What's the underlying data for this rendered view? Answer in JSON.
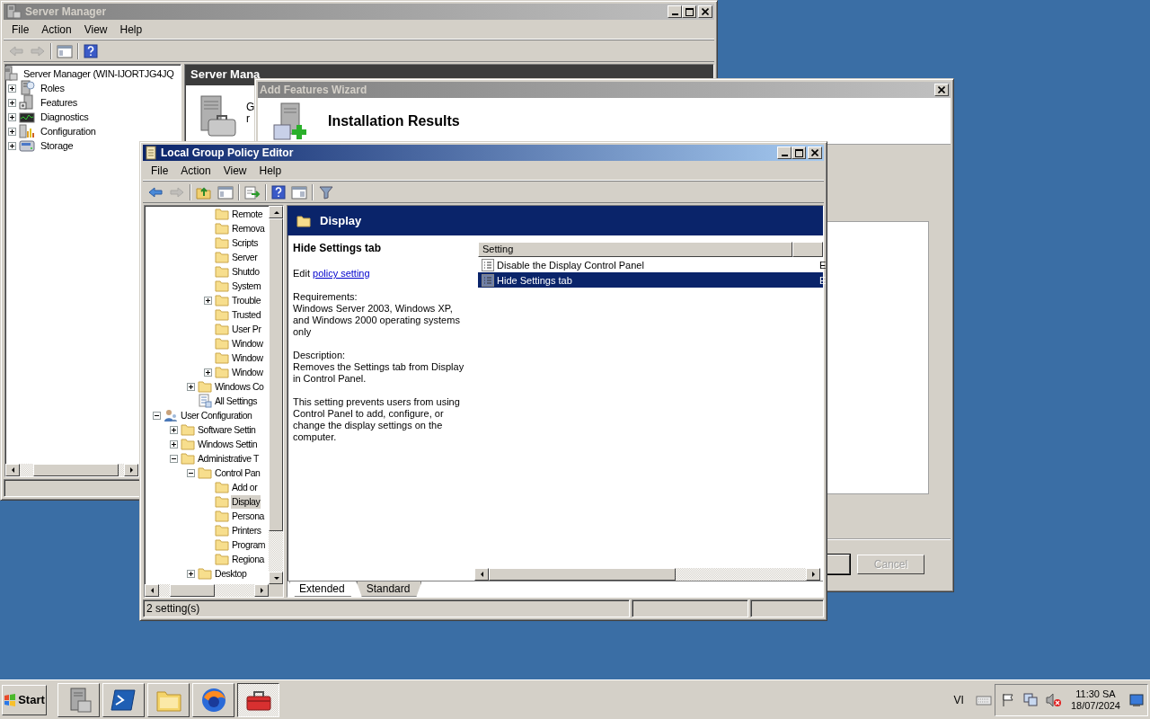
{
  "server_manager": {
    "title": "Server Manager",
    "menu": [
      "File",
      "Action",
      "View",
      "Help"
    ],
    "toolbar": [
      [
        {
          "kind": "back",
          "disabled": true
        },
        {
          "kind": "forward",
          "disabled": true
        }
      ],
      [
        {
          "kind": "tree-toggle",
          "disabled": false
        }
      ],
      [
        {
          "kind": "help",
          "disabled": false
        }
      ]
    ],
    "tree": [
      {
        "label": "Server Manager (WIN-IJORTJG4JQ",
        "kind": "server",
        "selected": false,
        "children": [
          {
            "label": "Roles",
            "kind": "roles",
            "expanded": false,
            "selected": false
          },
          {
            "label": "Features",
            "kind": "features",
            "expanded": false,
            "selected": false
          },
          {
            "label": "Diagnostics",
            "kind": "diagnostics",
            "expanded": false,
            "selected": false
          },
          {
            "label": "Configuration",
            "kind": "configuration",
            "expanded": false,
            "selected": false
          },
          {
            "label": "Storage",
            "kind": "storage",
            "expanded": false,
            "selected": false
          }
        ]
      }
    ],
    "pane_header": "Server Mana",
    "pane_text": [
      "G",
      "r"
    ]
  },
  "wizard": {
    "title": "Add Features Wizard",
    "heading": "Installation Results",
    "buttons": [
      {
        "disabled": false
      },
      {
        "label": "Cancel",
        "disabled": true
      }
    ]
  },
  "policy_editor": {
    "title": "Local Group Policy Editor",
    "menu": [
      "File",
      "Action",
      "View",
      "Help"
    ],
    "toolbar": [
      [
        {
          "kind": "back",
          "disabled": false
        },
        {
          "kind": "forward",
          "disabled": true
        }
      ],
      [
        {
          "kind": "up",
          "disabled": false
        },
        {
          "kind": "tree-toggle",
          "disabled": false
        }
      ],
      [
        {
          "kind": "export",
          "disabled": false
        }
      ],
      [
        {
          "kind": "help",
          "disabled": false
        },
        {
          "kind": "properties",
          "disabled": false
        }
      ],
      [
        {
          "kind": "filter",
          "disabled": false
        }
      ]
    ],
    "tree": [
      {
        "children": [
          {
            "children": [
              {
                "children": [
                  {
                    "label": "Remote",
                    "kind": "folder",
                    "selected": false
                  },
                  {
                    "label": "Remova",
                    "kind": "folder",
                    "selected": false
                  },
                  {
                    "label": "Scripts",
                    "kind": "folder",
                    "selected": false
                  },
                  {
                    "label": "Server",
                    "kind": "folder",
                    "selected": false
                  },
                  {
                    "label": "Shutdo",
                    "kind": "folder",
                    "selected": false
                  },
                  {
                    "label": "System",
                    "kind": "folder",
                    "selected": false
                  },
                  {
                    "label": "Trouble",
                    "kind": "folder",
                    "expanded": false,
                    "selected": false
                  },
                  {
                    "label": "Trusted",
                    "kind": "folder",
                    "selected": false
                  },
                  {
                    "label": "User Pr",
                    "kind": "folder",
                    "selected": false
                  },
                  {
                    "label": "Window",
                    "kind": "folder",
                    "selected": false
                  },
                  {
                    "label": "Window",
                    "kind": "folder",
                    "selected": false
                  },
                  {
                    "label": "Window",
                    "kind": "folder",
                    "expanded": false,
                    "selected": false
                  }
                ]
              },
              {
                "label": "Windows Co",
                "kind": "folder",
                "expanded": false,
                "selected": false
              },
              {
                "label": "All Settings",
                "kind": "settings",
                "selected": false
              }
            ]
          }
        ]
      },
      {
        "label": "User Configuration",
        "kind": "user",
        "expanded": true,
        "selected": false,
        "children": [
          {
            "label": "Software Settin",
            "kind": "folder",
            "expanded": false,
            "selected": false
          },
          {
            "label": "Windows Settin",
            "kind": "folder",
            "expanded": false,
            "selected": false
          },
          {
            "label": "Administrative T",
            "kind": "folder",
            "expanded": true,
            "selected": false,
            "children": [
              {
                "label": "Control Pan",
                "kind": "folder",
                "expanded": true,
                "selected": false,
                "children": [
                  {
                    "label": "Add or",
                    "kind": "folder",
                    "selected": false
                  },
                  {
                    "label": "Display",
                    "kind": "folder",
                    "selected": true
                  },
                  {
                    "label": "Persona",
                    "kind": "folder",
                    "selected": false
                  },
                  {
                    "label": "Printers",
                    "kind": "folder",
                    "selected": false
                  },
                  {
                    "label": "Program",
                    "kind": "folder",
                    "selected": false
                  },
                  {
                    "label": "Regiona",
                    "kind": "folder",
                    "selected": false
                  }
                ]
              },
              {
                "label": "Desktop",
                "kind": "folder",
                "expanded": false,
                "selected": false
              }
            ]
          }
        ]
      }
    ],
    "folder": "Display",
    "details": {
      "title": "Hide Settings tab",
      "edit_prefix": "Edit",
      "edit_link": "policy setting",
      "requirements_label": "Requirements:",
      "requirements": "Windows Server 2003, Windows XP, and Windows 2000 operating systems only",
      "description_label": "Description:",
      "description": "Removes the Settings tab from Display in Control Panel.",
      "note": "This setting prevents users from using Control Panel to add, configure, or change the display settings on the computer."
    },
    "columns": [
      "Setting"
    ],
    "rows": [
      {
        "setting": "Disable the Display Control Panel",
        "column_2": "E",
        "selected": false
      },
      {
        "setting": "Hide Settings tab",
        "column_2": "E",
        "selected": true
      }
    ],
    "tabs": [
      {
        "label": "Extended",
        "selected": true
      },
      {
        "label": "Standard",
        "selected": false
      }
    ],
    "status": "2 setting(s)"
  },
  "taskbar": {
    "start": "Start",
    "apps": [
      {
        "kind": "server",
        "selected": false
      },
      {
        "kind": "terminal",
        "selected": false
      },
      {
        "kind": "explorer",
        "selected": false
      },
      {
        "kind": "browser",
        "selected": false
      },
      {
        "kind": "toolbox",
        "selected": true
      }
    ],
    "language": "VI",
    "time": "11:30 SA",
    "date": "18/07/2024"
  }
}
